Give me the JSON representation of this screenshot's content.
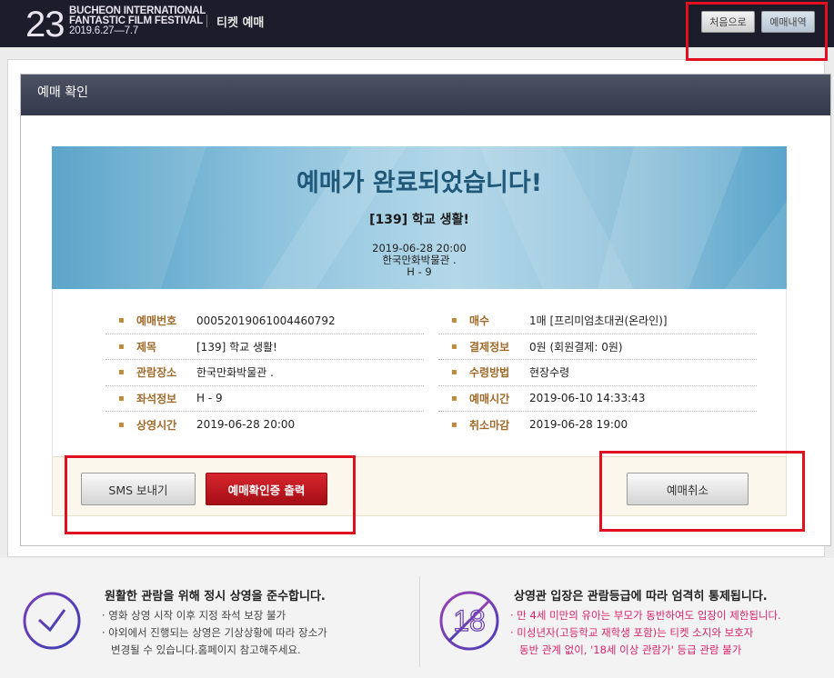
{
  "header": {
    "logo_number": "23",
    "logo_line1": "BUCHEON INTERNATIONAL",
    "logo_line2": "FANTASTIC FILM FESTIVAL",
    "logo_date": "2019.6.27—7.7",
    "section_title": "티켓 예매",
    "home_button": "처음으로",
    "history_button": "예매내역"
  },
  "card": {
    "title": "예매 확인"
  },
  "banner": {
    "title": "예매가 완료되었습니다!",
    "movie": "[139] 학교 생활!",
    "datetime": "2019-06-28 20:00",
    "venue": "한국만화박물관 .",
    "seat": "H - 9"
  },
  "details": {
    "left": [
      {
        "label": "예매번호",
        "value": "00052019061004460792"
      },
      {
        "label": "제목",
        "value": "[139] 학교 생활!"
      },
      {
        "label": "관람장소",
        "value": "한국만화박물관 ."
      },
      {
        "label": "좌석정보",
        "value": "H - 9"
      },
      {
        "label": "상영시간",
        "value": "2019-06-28 20:00"
      }
    ],
    "right": [
      {
        "label": "매수",
        "value": "1매 [프리미엄초대권(온라인)]"
      },
      {
        "label": "결제정보",
        "value": "0원 (회원결제: 0원)"
      },
      {
        "label": "수령방법",
        "value": "현장수령"
      },
      {
        "label": "예매시간",
        "value": "2019-06-10 14:33:43"
      },
      {
        "label": "취소마감",
        "value": "2019-06-28 19:00"
      }
    ]
  },
  "actions": {
    "sms": "SMS 보내기",
    "print": "예매확인증 출력",
    "cancel": "예매취소"
  },
  "footer": {
    "left_title": "원활한 관람을 위해 정시 상영을 준수합니다.",
    "left_lines": [
      "· 영화 상영 시작 이후 지정 좌석 보장 불가",
      "· 야외에서 진행되는 상영은 기상상황에 따라 장소가",
      "  변경될 수 있습니다.홈페이지 참고해주세요."
    ],
    "right_title": "상영관 입장은 관람등급에 따라 엄격히 통제됩니다.",
    "right_lines": [
      "· 만 4세 미만의 유아는 부모가 동반하여도 입장이 제한됩니다.",
      "· 미성년자(고등학교 재학생 포함)는 티켓 소지와 보호자",
      "  동반 관계 없이, '18세 이상 관람가' 등급 관람 불가"
    ],
    "age_icon_number": "18"
  },
  "colors": {
    "accent_red": "#e01020",
    "header_bg": "#1c1c2b",
    "label_brown": "#a06a2a",
    "banner_title": "#20587a",
    "notice_pink": "#d8236b"
  },
  "icons": [
    "clock-icon",
    "age-restriction-icon"
  ]
}
